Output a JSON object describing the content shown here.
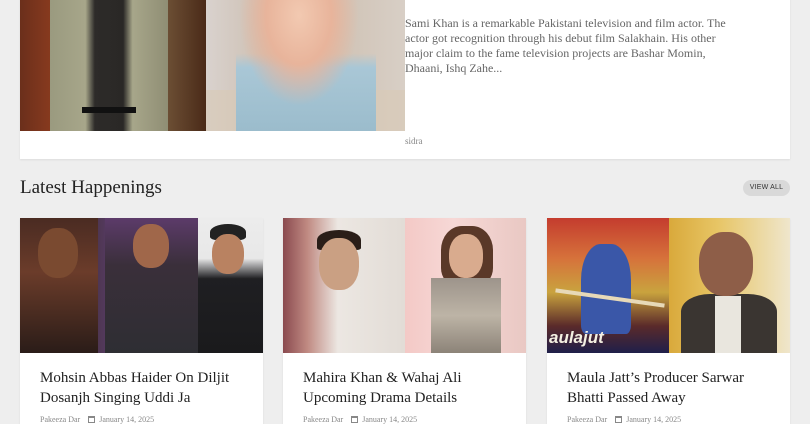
{
  "featured": {
    "excerpt": "Sami Khan is a remarkable Pakistani television and film actor. The actor got recognition through his debut film Salakhain. His other major claim to the fame television projects are Bashar Momin, Dhaani, Ishq Zahe...",
    "author": "sidra"
  },
  "section": {
    "title": "Latest Happenings",
    "view_all": "VIEW ALL"
  },
  "articles": [
    {
      "title": "Mohsin Abbas Haider On Diljit Dosanjh Singing Uddi Ja",
      "author": "Pakeeza Dar",
      "date": "January 14, 2025"
    },
    {
      "title": "Mahira Khan & Wahaj Ali Upcoming Drama Details",
      "author": "Pakeeza Dar",
      "date": "January 14, 2025"
    },
    {
      "title": "Maula Jatt’s Producer Sarwar Bhatti Passed Away",
      "author": "Pakeeza Dar",
      "date": "January 14, 2025",
      "thumb_text": "aulajut"
    }
  ],
  "icons": {
    "date": "calendar-icon"
  }
}
